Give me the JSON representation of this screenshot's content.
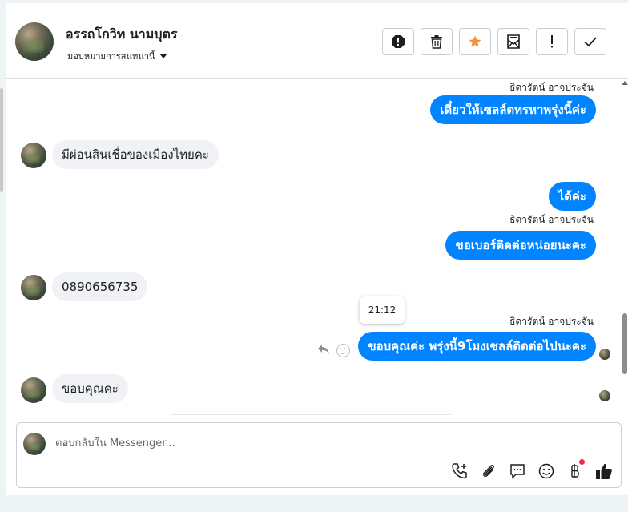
{
  "header": {
    "name": "อรรถโกวิท นามบุตร",
    "assign": "มอบหมายการสนทนานี้",
    "buttons": [
      "spam-icon",
      "trash-icon",
      "star-icon",
      "mark-unread-icon",
      "important-icon",
      "done-icon"
    ],
    "star_color": "#f7923b"
  },
  "messages": {
    "sender_name": "ธิดารัตน์ อาจประจัน",
    "out1": "เดี๋ยวให้เซลล์ตทรหาพรุ่งนี้ค่ะ",
    "in1": "มีผ่อนสินเชื่อของเมืองไทยคะ",
    "out2": "ได้ค่ะ",
    "out3": "ขอเบอร์ติดต่อหน่อยนะคะ",
    "in2": "0890656735",
    "tooltip_time": "21:12",
    "out4": "ขอบคุณค่ะ พรุ่งนี้9โมงเซลล์ติดต่อไปนะคะ",
    "in3": "ขอบคุณคะ"
  },
  "composer": {
    "placeholder": "ตอบกลับใน Messenger..."
  },
  "colors": {
    "outgoing_bubble": "#0084ff",
    "incoming_bubble": "#f0f2f5",
    "notification_dot": "#f02849"
  }
}
